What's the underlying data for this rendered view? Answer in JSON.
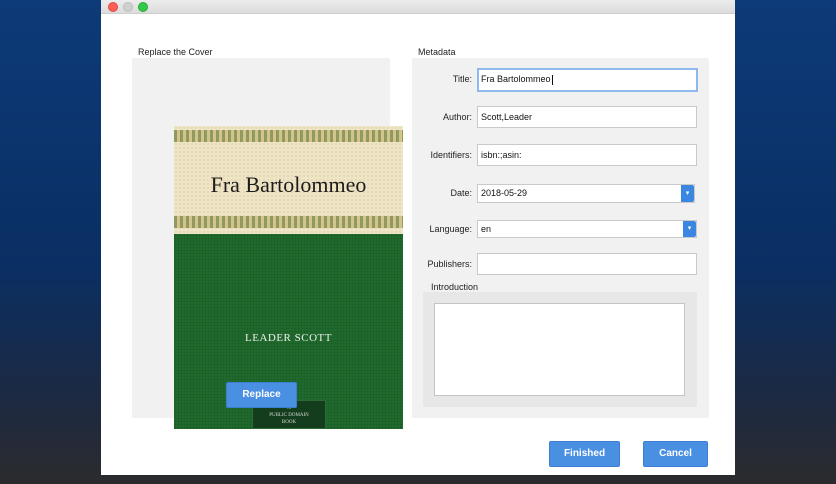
{
  "cover_section": {
    "label": "Replace the Cover",
    "replace_button": "Replace"
  },
  "cover": {
    "title": "Fra Bartolommeo",
    "author": "LEADER SCOTT",
    "badge_lines": [
      "A",
      "PUBLIC DOMAIN",
      "BOOK"
    ]
  },
  "metadata": {
    "label": "Metadata",
    "title": {
      "label": "Title:",
      "value": "Fra Bartolommeo"
    },
    "author": {
      "label": "Author:",
      "value": "Scott,Leader"
    },
    "identifiers": {
      "label": "Identifiers:",
      "value": "isbn:;asin:"
    },
    "date": {
      "label": "Date:",
      "value": "2018-05-29"
    },
    "language": {
      "label": "Language:",
      "value": "en"
    },
    "publishers": {
      "label": "Publishers:",
      "value": ""
    },
    "introduction": {
      "label": "Introduction",
      "value": ""
    }
  },
  "footer": {
    "finished": "Finished",
    "cancel": "Cancel"
  },
  "colors": {
    "accent": "#4a90e2",
    "cover_green": "#1f6a2c",
    "cover_cream": "#efe5c4"
  }
}
